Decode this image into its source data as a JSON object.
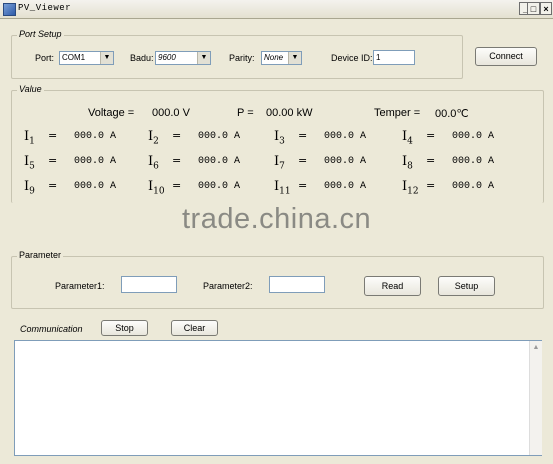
{
  "window": {
    "title": "PV_Viewer",
    "minimize": "_",
    "maximize": "□",
    "close": "×"
  },
  "port_setup": {
    "legend": "Port Setup",
    "port_label": "Port:",
    "port_value": "COM1",
    "badu_label": "Badu:",
    "badu_value": "9600",
    "parity_label": "Parity:",
    "parity_value": "None",
    "device_id_label": "Device ID:",
    "device_id_value": "1",
    "connect_label": "Connect",
    "dropdown_glyph": "▼"
  },
  "value": {
    "legend": "Value",
    "voltage_label": "Voltage =",
    "voltage_value": "000.0 V",
    "power_label": "P =",
    "power_value": "00.00 kW",
    "temper_label": "Temper =",
    "temper_value": "00.0℃",
    "current_symbol": "I",
    "currents": [
      {
        "index": "1",
        "eq": "=",
        "value": "000.0 A"
      },
      {
        "index": "2",
        "eq": "=",
        "value": "000.0 A"
      },
      {
        "index": "3",
        "eq": "=",
        "value": "000.0 A"
      },
      {
        "index": "4",
        "eq": "=",
        "value": "000.0 A"
      },
      {
        "index": "5",
        "eq": "=",
        "value": "000.0 A"
      },
      {
        "index": "6",
        "eq": "=",
        "value": "000.0 A"
      },
      {
        "index": "7",
        "eq": "=",
        "value": "000.0 A"
      },
      {
        "index": "8",
        "eq": "=",
        "value": "000.0 A"
      },
      {
        "index": "9",
        "eq": "=",
        "value": "000.0 A"
      },
      {
        "index": "10",
        "eq": "=",
        "value": "000.0 A"
      },
      {
        "index": "11",
        "eq": "=",
        "value": "000.0 A"
      },
      {
        "index": "12",
        "eq": "=",
        "value": "000.0 A"
      }
    ]
  },
  "watermark": "trade.china.cn",
  "parameter": {
    "legend": "Parameter",
    "param1_label": "Parameter1:",
    "param1_value": "",
    "param2_label": "Parameter2:",
    "param2_value": "",
    "read_label": "Read",
    "setup_label": "Setup"
  },
  "communication": {
    "label": "Communication",
    "stop_label": "Stop",
    "clear_label": "Clear",
    "log_text": "",
    "scroll_up": "▲"
  }
}
